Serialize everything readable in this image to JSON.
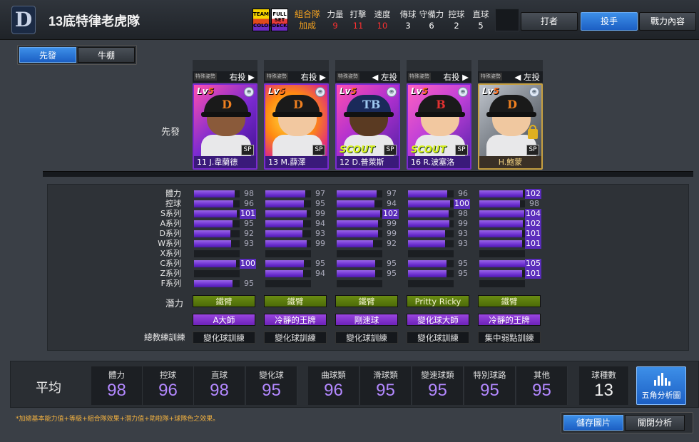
{
  "header": {
    "logo_icon": "tigers-d-logo-icon",
    "team_name": "13底特律老虎隊",
    "badges": [
      {
        "name": "team-color-badge",
        "text": "TEAM COLOR"
      },
      {
        "name": "full-set-badge",
        "text": "FULL SET DECK"
      }
    ],
    "bonus_label_1": "組合隊",
    "bonus_label_2": "加成",
    "stats": [
      {
        "label": "力量",
        "value": "9",
        "red": true
      },
      {
        "label": "打擊",
        "value": "11",
        "red": true
      },
      {
        "label": "速度",
        "value": "10",
        "red": true
      },
      {
        "label": "傳球",
        "value": "3",
        "red": false
      },
      {
        "label": "守備力",
        "value": "6",
        "red": false
      },
      {
        "label": "控球",
        "value": "2",
        "red": false
      },
      {
        "label": "直球",
        "value": "5",
        "red": false
      }
    ],
    "buttons": [
      {
        "label": "打者",
        "active": false
      },
      {
        "label": "投手",
        "active": true
      },
      {
        "label": "戰力內容",
        "active": false
      }
    ]
  },
  "rotation_tabs": [
    {
      "label": "先發",
      "active": true
    },
    {
      "label": "牛棚",
      "active": false
    }
  ],
  "row_label": "先發",
  "players": [
    {
      "pos_tag": "特殊姿勢",
      "hand": "右投 ▶",
      "lv_prefix": "Lv",
      "lv": "5",
      "name": "11 J.韋蘭德",
      "letter": "D",
      "badge": "SP",
      "scout": "",
      "gold": false,
      "locked": false,
      "bg": "linear-gradient(135deg,#ff4fb0,#7a2ad0 50%,#3b0f8a)",
      "skin": "#8a5a3a"
    },
    {
      "pos_tag": "特殊姿勢",
      "hand": "右投 ▶",
      "lv_prefix": "Lv",
      "lv": "5",
      "name": "13 M.薛澤",
      "letter": "D",
      "badge": "SP",
      "scout": "",
      "gold": false,
      "locked": false,
      "bg": "radial-gradient(circle at 40% 40%,#ffe040,#ff8a10 40%,#e0307a 70%,#6a20b0)",
      "skin": "#f2c8a0"
    },
    {
      "pos_tag": "特殊姿勢",
      "hand": "◀ 左投",
      "lv_prefix": "Lv",
      "lv": "5",
      "name": "12 D.普萊斯",
      "letter": "TB",
      "badge": "SP",
      "scout": "SCOUT",
      "gold": false,
      "locked": false,
      "bg": "linear-gradient(135deg,#ff4fb0,#b030d0 45%,#4a20a0)",
      "skin": "#5a3a22"
    },
    {
      "pos_tag": "特殊姿勢",
      "hand": "右投 ▶",
      "lv_prefix": "Lv",
      "lv": "5",
      "name": "16 R.波塞洛",
      "letter": "B",
      "badge": "SP",
      "scout": "SCOUT",
      "gold": false,
      "locked": false,
      "bg": "linear-gradient(135deg,#ff60c0,#c040d8 45%,#5020a8)",
      "skin": "#f2c8a0"
    },
    {
      "pos_tag": "特殊姿勢",
      "hand": "◀ 左投",
      "lv_prefix": "Lv",
      "lv": "5",
      "name": "H.鮑蒙",
      "letter": "D",
      "badge": "SP",
      "scout": "",
      "gold": true,
      "locked": true,
      "bg": "linear-gradient(135deg,#bfc4cc,#7a8088 50%,#3a3f46)",
      "skin": "#f0c8a0"
    }
  ],
  "stat_labels": [
    "體力",
    "控球",
    "S系列",
    "A系列",
    "D系列",
    "W系列",
    "X系列",
    "C系列",
    "Z系列",
    "F系列"
  ],
  "stat_values": [
    [
      98,
      96,
      101,
      95,
      92,
      93,
      null,
      100,
      null,
      95
    ],
    [
      97,
      95,
      99,
      94,
      93,
      99,
      null,
      95,
      94,
      null
    ],
    [
      97,
      94,
      102,
      99,
      99,
      92,
      null,
      95,
      95,
      null
    ],
    [
      96,
      100,
      98,
      99,
      93,
      93,
      null,
      95,
      95,
      null
    ],
    [
      102,
      98,
      104,
      102,
      101,
      101,
      null,
      105,
      101,
      null
    ]
  ],
  "potential_label": "潛力",
  "potentials": [
    "鐵臂",
    "鐵臂",
    "鐵臂",
    "Pritty Ricky",
    "鐵臂"
  ],
  "skills": [
    "A大師",
    "冷靜的王牌",
    "剛速球",
    "變化球大師",
    "冷靜的王牌"
  ],
  "coach_label": "總教練訓練",
  "coach": [
    "變化球訓練",
    "變化球訓練",
    "變化球訓練",
    "變化球訓練",
    "集中弱點訓練"
  ],
  "average": {
    "title": "平均",
    "group1": [
      {
        "label": "體力",
        "value": "98"
      },
      {
        "label": "控球",
        "value": "96"
      },
      {
        "label": "直球",
        "value": "98"
      },
      {
        "label": "變化球",
        "value": "95"
      }
    ],
    "group2": [
      {
        "label": "曲球類",
        "value": "96"
      },
      {
        "label": "滑球類",
        "value": "95"
      },
      {
        "label": "變速球類",
        "value": "95"
      },
      {
        "label": "特別球路",
        "value": "95"
      },
      {
        "label": "其他",
        "value": "95"
      }
    ],
    "pitch_count_label": "球種數",
    "pitch_count": "13",
    "radar_icon": "bar-chart-icon",
    "radar_label": "五角分析圖"
  },
  "footnote": "*加總基本能力值+等級+組合隊效果+潛力值+助啦隊+球隊色之效果。",
  "bottom_buttons": [
    {
      "label": "儲存圖片",
      "active": true
    },
    {
      "label": "關閉分析",
      "active": false
    }
  ]
}
